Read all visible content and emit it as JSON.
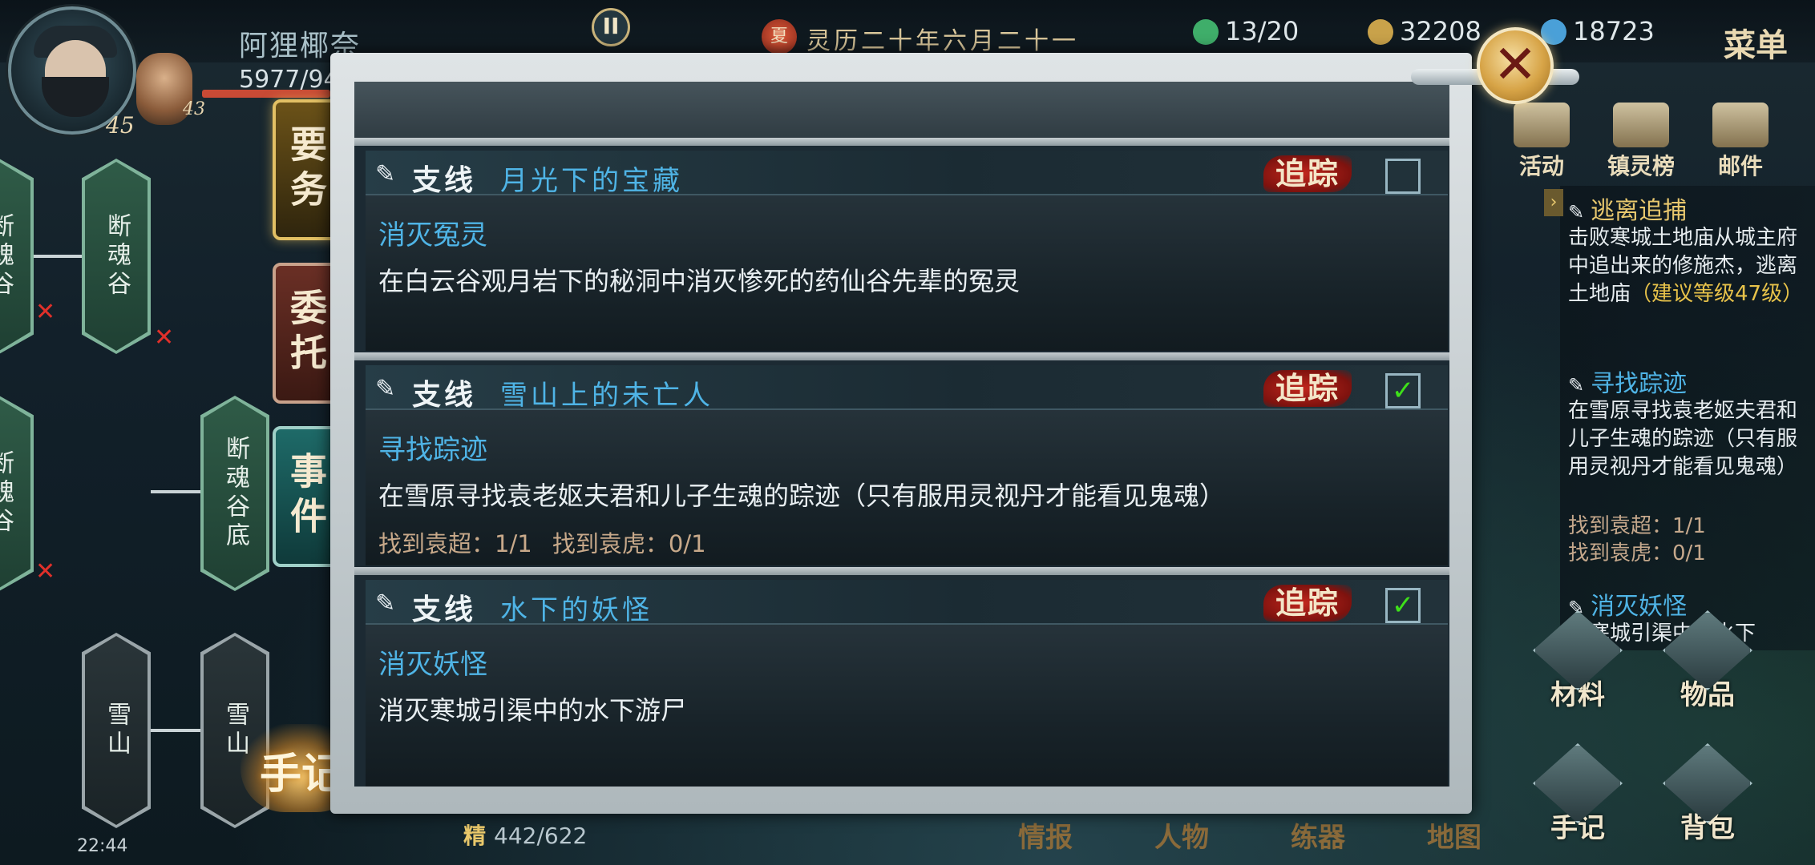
{
  "player": {
    "name": "阿狸椰奈",
    "hp": "5977/94",
    "level": "45",
    "companion_level": "43",
    "hp_small": "4"
  },
  "date": {
    "icon": "夏",
    "text": "灵历二十年六月二十一"
  },
  "resources": [
    {
      "name": "energy",
      "value": "13/20",
      "color": "#3fae6a"
    },
    {
      "name": "coins",
      "value": "32208",
      "color": "#c9a24a"
    },
    {
      "name": "gems",
      "value": "18723",
      "color": "#4aa0d8"
    }
  ],
  "menu_label": "菜单",
  "close_label": "✕",
  "pause_label": "II",
  "top_icons": [
    "活动",
    "镇灵榜",
    "邮件"
  ],
  "tabs": [
    "要务",
    "委托",
    "事件"
  ],
  "shouji_label": "手记",
  "map_nodes": [
    {
      "label": "断魂谷",
      "style": "green"
    },
    {
      "label": "断魂谷",
      "style": "green"
    },
    {
      "label": "断魂谷",
      "style": "green"
    },
    {
      "label": "断魂谷底",
      "style": "green"
    },
    {
      "label": "雪山",
      "style": "dark"
    },
    {
      "label": "雪山",
      "style": "dark"
    }
  ],
  "status_bar": {
    "time": "22:44"
  },
  "stamina": {
    "label": "精",
    "value": "442/622"
  },
  "quests": [
    {
      "kind": "支线",
      "name": "月光下的宝藏",
      "track": "追踪",
      "checked": false,
      "objective": "消灭冤灵",
      "description": "在白云谷观月岩下的秘洞中消灭惨死的药仙谷先辈的冤灵",
      "progress": ""
    },
    {
      "kind": "支线",
      "name": "雪山上的未亡人",
      "track": "追踪",
      "checked": true,
      "objective": "寻找踪迹",
      "description": "在雪原寻找袁老妪夫君和儿子生魂的踪迹（只有服用灵视丹才能看见鬼魂）",
      "progress": "找到袁超：1/1 找到袁虎：0/1"
    },
    {
      "kind": "支线",
      "name": "水下的妖怪",
      "track": "追踪",
      "checked": true,
      "objective": "消灭妖怪",
      "description": "消灭寒城引渠中的水下游尸",
      "progress": ""
    }
  ],
  "quest_log": {
    "q1_title": "逃离追捕",
    "q1_desc": "击败寒城土地庙从城主府中追出来的修施杰，逃离土地庙",
    "q1_hint": "（建议等级47级）",
    "q2_title": "寻找踪迹",
    "q2_desc": "在雪原寻找袁老妪夫君和儿子生魂的踪迹（只有服用灵视丹才能看见鬼魂）",
    "q2_p1": "找到袁超：1/1",
    "q2_p2": "找到袁虎：0/1",
    "q3_title": "消灭妖怪",
    "q3_desc": "灭寒城引渠中的水下"
  },
  "side_buttons": [
    "材料",
    "物品",
    "手记",
    "背包"
  ],
  "bottom_nav": [
    "情报",
    "人物",
    "练器",
    "地图"
  ]
}
